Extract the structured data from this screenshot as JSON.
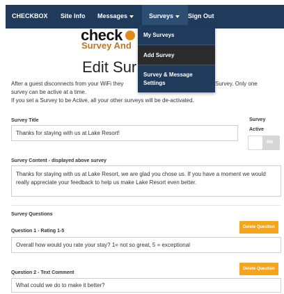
{
  "nav": {
    "brand": "CHECKBOX",
    "site_info": "Site Info",
    "messages": "Messages",
    "surveys": "Surveys",
    "sign_out": "Sign Out"
  },
  "dropdown": {
    "items": [
      {
        "label": "My Surveys"
      },
      {
        "label": "Add Survey"
      },
      {
        "label": "Survey & Message Settings"
      }
    ]
  },
  "logo": {
    "top": "check",
    "sub": "Survey And"
  },
  "page": {
    "title": "Edit Sur",
    "intro": [
      "After a guest disconnects from your WiFi they",
      "dback Survey. Only one",
      "survey can be active at a time.",
      "If you set a Survey to be Active, all your other surveys will be de-activated."
    ]
  },
  "form": {
    "survey_title_label": "Survey Title",
    "survey_title_value": "Thanks for staying with us at Lake Resort!",
    "active_label_line1": "Survey",
    "active_label_line2": "Active",
    "active_toggle_text": "No",
    "content_label": "Survey Content - displayed above survey",
    "content_value": "Thanks for staying with us at Lake Resort, we are glad you chose us. If you have a moment we would really appreciate your feedback to help us make Lake Resort even better.",
    "questions_label": "Survey Questions",
    "questions": [
      {
        "label": "Question 1 - Rating 1-5",
        "value": "Overall how would you rate your stay? 1= not so great, 5 = exceptional",
        "delete": "Delete Question"
      },
      {
        "label": "Question 2 - Text Comment",
        "value": "What could we do to make it better?",
        "delete": "Delete Question"
      }
    ]
  },
  "colors": {
    "navbar": "#1f3a5a",
    "accent": "#f4a51c",
    "logo_orange": "#c0741e"
  }
}
